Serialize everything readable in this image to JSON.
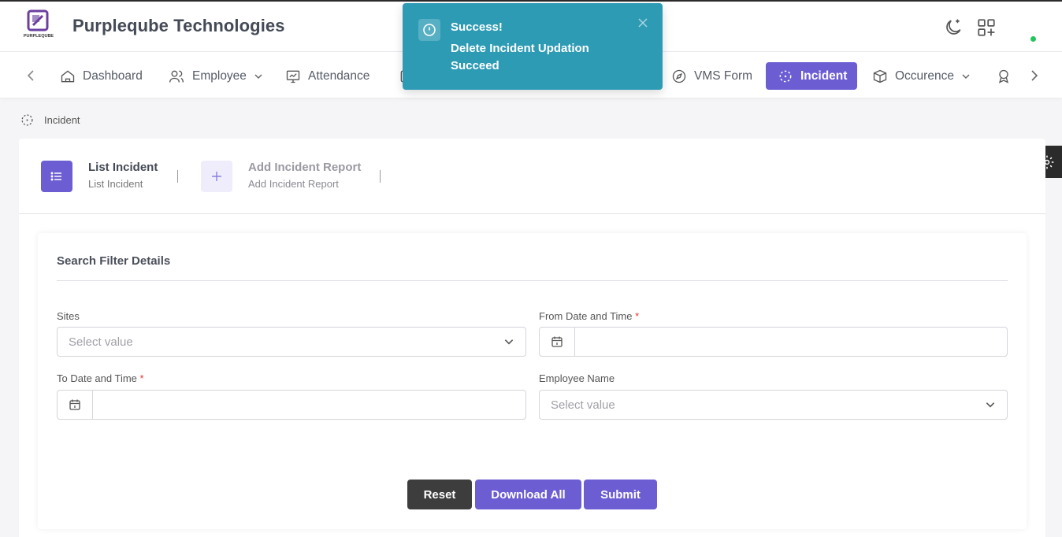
{
  "header": {
    "brand": "Purpleqube Technologies",
    "logo_text": "PURPLEQUBE"
  },
  "nav": {
    "items": [
      {
        "label": "Dashboard",
        "icon": "home-icon"
      },
      {
        "label": "Employee",
        "icon": "users-icon",
        "dropdown": true
      },
      {
        "label": "Attendance",
        "icon": "presentation-icon"
      },
      {
        "label": "VMS Form",
        "icon": "compass-icon"
      },
      {
        "label": "Incident",
        "icon": "scan-icon",
        "active": true
      },
      {
        "label": "Occurence",
        "icon": "box-icon",
        "dropdown": true
      }
    ]
  },
  "breadcrumb": {
    "label": "Incident"
  },
  "tabs": {
    "list_title": "List Incident",
    "list_sub": "List Incident",
    "add_title": "Add Incident Report",
    "add_sub": "Add Incident Report"
  },
  "filter": {
    "title": "Search Filter Details",
    "sites_label": "Sites",
    "sites_placeholder": "Select value",
    "from_label": "From Date and Time",
    "to_label": "To Date and Time",
    "employee_label": "Employee Name",
    "employee_placeholder": "Select value",
    "required_mark": "*"
  },
  "buttons": {
    "reset": "Reset",
    "download_all": "Download All",
    "submit": "Submit"
  },
  "toast": {
    "title": "Success!",
    "message": "Delete Incident Updation Succeed",
    "color": "#2e9bb5"
  },
  "colors": {
    "accent": "#6c5dd3",
    "dark_button": "#3d3d3d",
    "online": "#22c55e"
  }
}
